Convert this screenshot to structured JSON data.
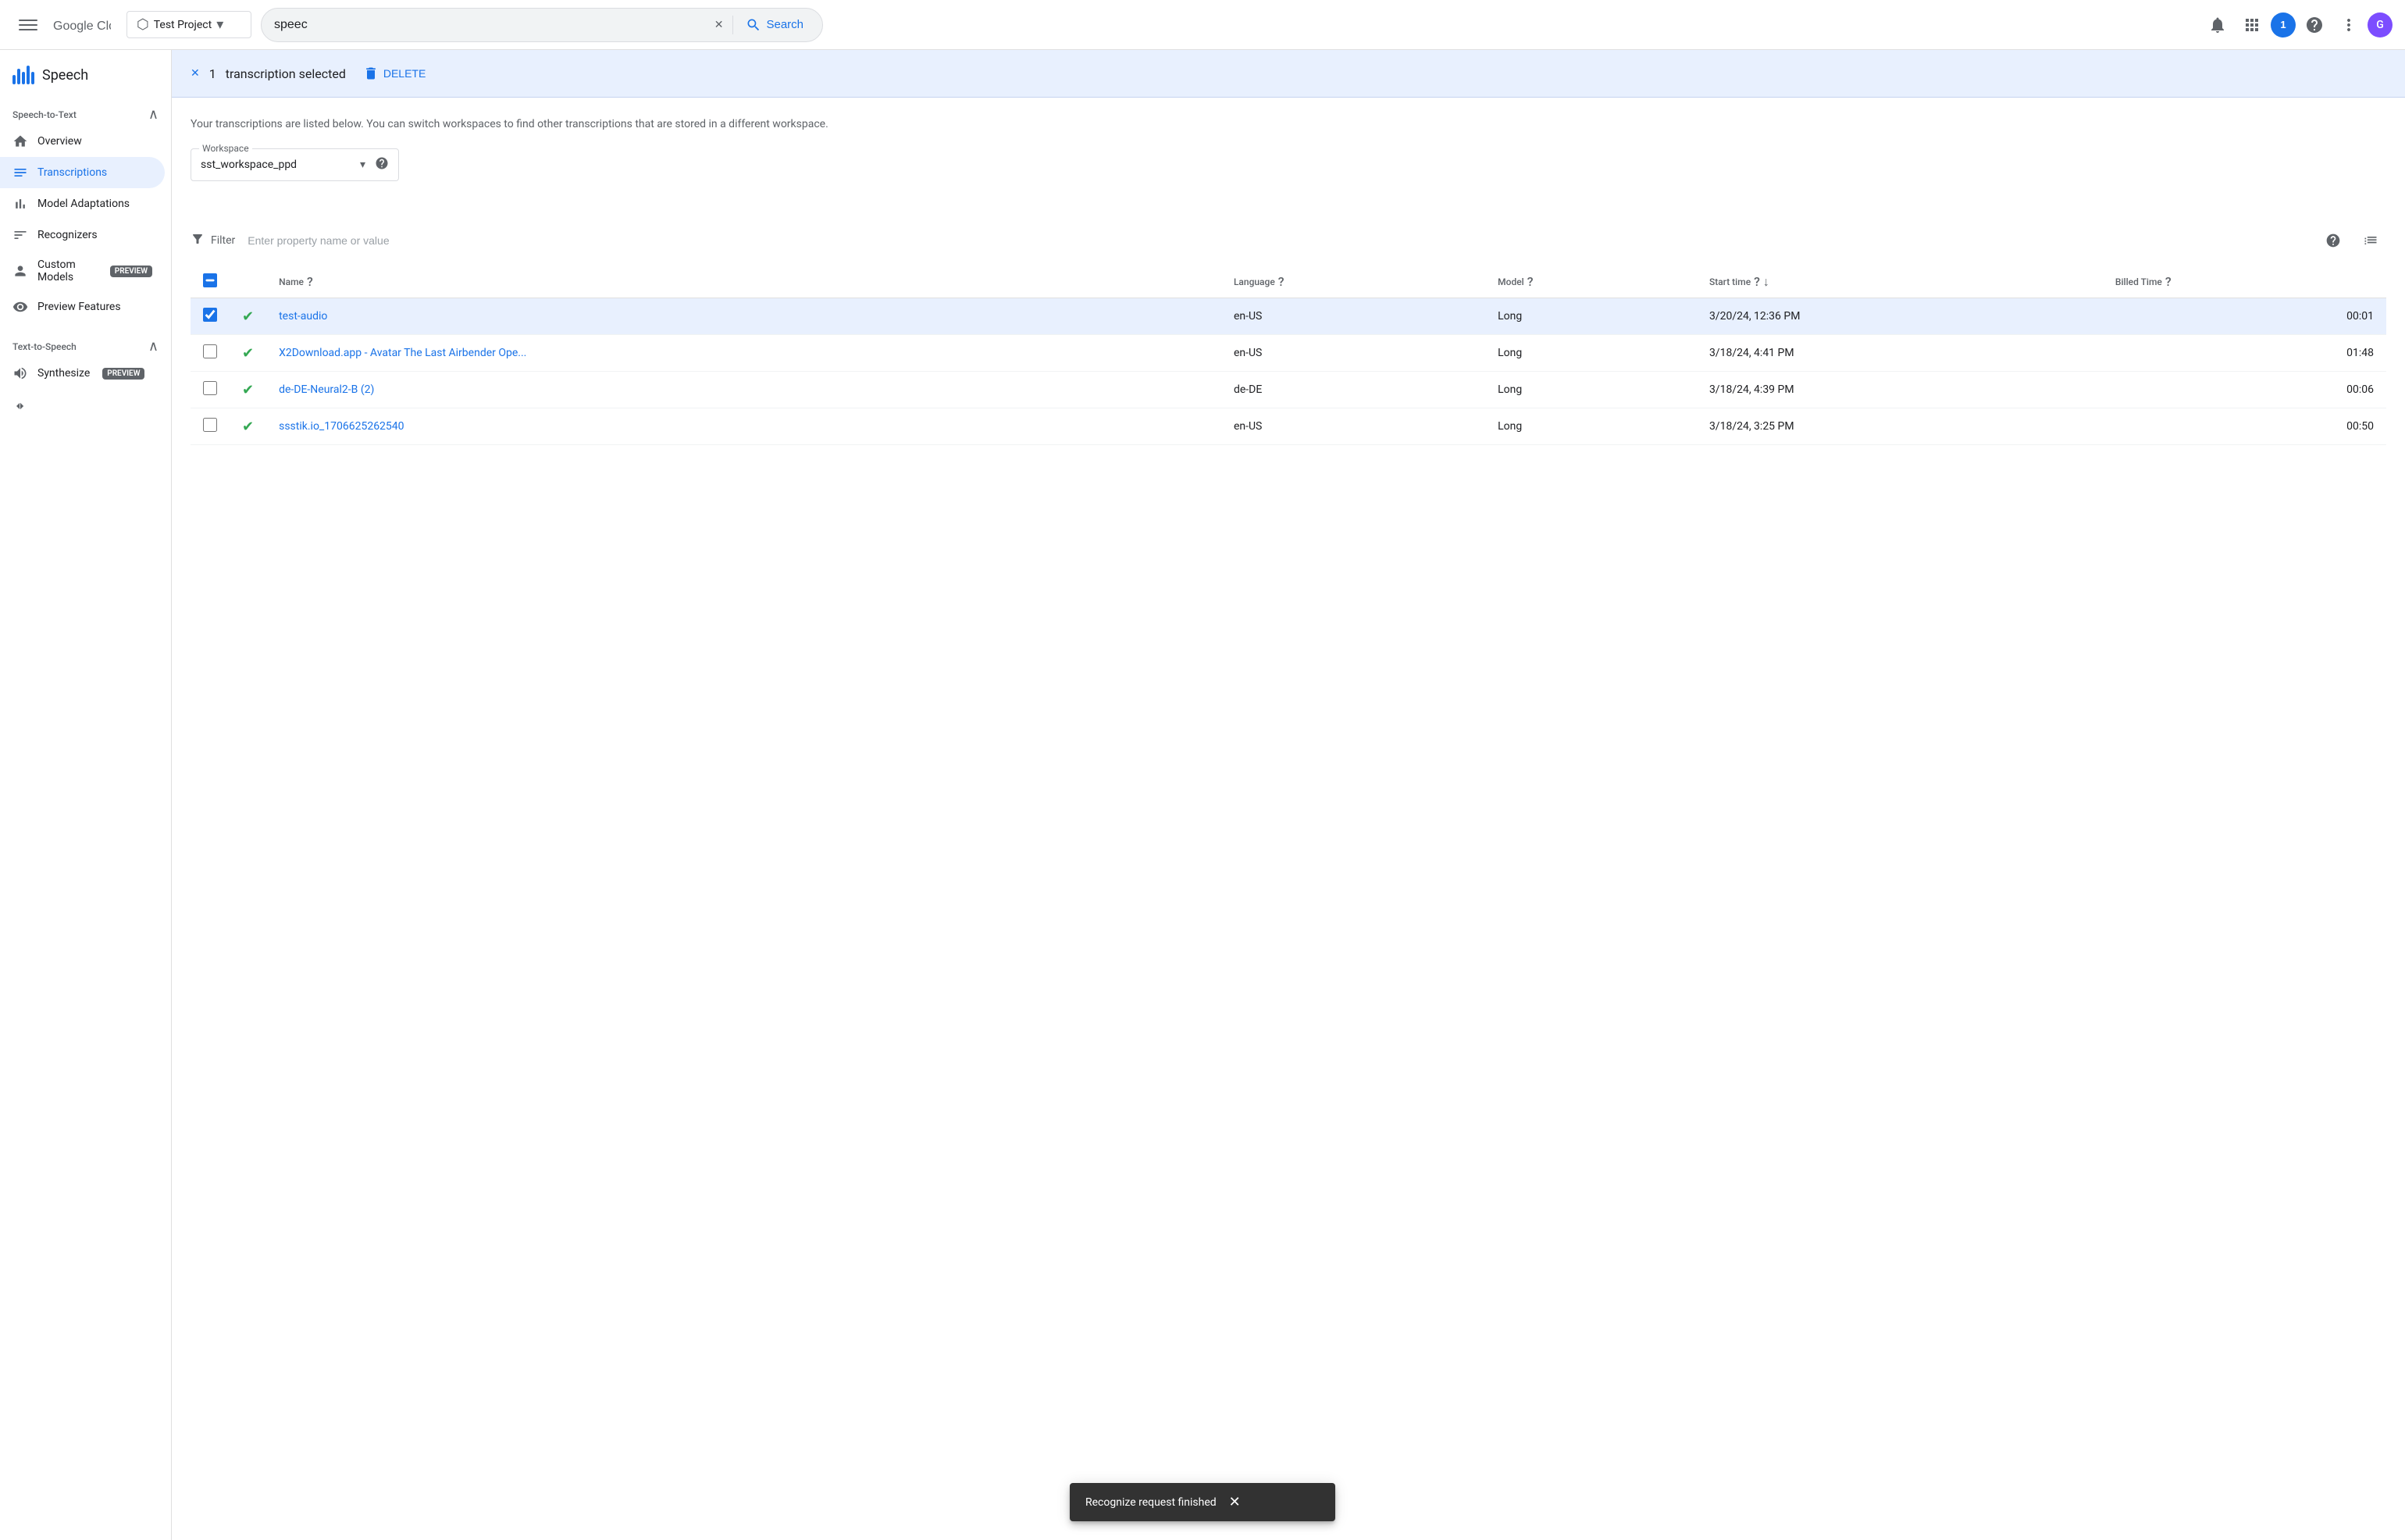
{
  "topbar": {
    "project_name": "Test Project",
    "search_value": "speec",
    "search_placeholder": "Search",
    "notification_count": "1",
    "avatar_letter": "G"
  },
  "sidebar": {
    "app_name": "Speech",
    "stt_section": "Speech-to-Text",
    "items": [
      {
        "id": "overview",
        "label": "Overview",
        "icon": "home"
      },
      {
        "id": "transcriptions",
        "label": "Transcriptions",
        "icon": "list",
        "active": true
      },
      {
        "id": "model-adaptations",
        "label": "Model Adaptations",
        "icon": "bar-chart"
      },
      {
        "id": "recognizers",
        "label": "Recognizers",
        "icon": "menu"
      },
      {
        "id": "custom-models",
        "label": "Custom Models",
        "icon": "person",
        "badge": "PREVIEW"
      },
      {
        "id": "preview-features",
        "label": "Preview Features",
        "icon": "preview"
      }
    ],
    "tts_section": "Text-to-Speech",
    "tts_items": [
      {
        "id": "synthesize",
        "label": "Synthesize",
        "icon": "wave",
        "badge": "PREVIEW"
      }
    ],
    "collapse_label": "Collapse"
  },
  "selection_bar": {
    "count": "1",
    "text": "transcription selected",
    "delete_label": "DELETE"
  },
  "main": {
    "description": "Your transcriptions are listed below. You can switch workspaces to find other transcriptions that are stored in a different workspace.",
    "workspace": {
      "label": "Workspace",
      "value": "sst_workspace_ppd"
    },
    "filter_placeholder": "Enter property name or value",
    "columns": [
      {
        "id": "name",
        "label": "Name"
      },
      {
        "id": "language",
        "label": "Language"
      },
      {
        "id": "model",
        "label": "Model"
      },
      {
        "id": "start_time",
        "label": "Start time"
      },
      {
        "id": "billed_time",
        "label": "Billed Time"
      }
    ],
    "rows": [
      {
        "id": "1",
        "name": "test-audio",
        "language": "en-US",
        "model": "Long",
        "start_time": "3/20/24, 12:36 PM",
        "billed_time": "00:01",
        "selected": true,
        "status": "success"
      },
      {
        "id": "2",
        "name": "X2Download.app - Avatar The Last Airbender Ope...",
        "language": "en-US",
        "model": "Long",
        "start_time": "3/18/24, 4:41 PM",
        "billed_time": "01:48",
        "selected": false,
        "status": "success"
      },
      {
        "id": "3",
        "name": "de-DE-Neural2-B (2)",
        "language": "de-DE",
        "model": "Long",
        "start_time": "3/18/24, 4:39 PM",
        "billed_time": "00:06",
        "selected": false,
        "status": "success"
      },
      {
        "id": "4",
        "name": "ssstik.io_1706625262540",
        "language": "en-US",
        "model": "Long",
        "start_time": "3/18/24, 3:25 PM",
        "billed_time": "00:50",
        "selected": false,
        "status": "success"
      }
    ]
  },
  "snackbar": {
    "message": "Recognize request finished",
    "close_label": "✕"
  }
}
